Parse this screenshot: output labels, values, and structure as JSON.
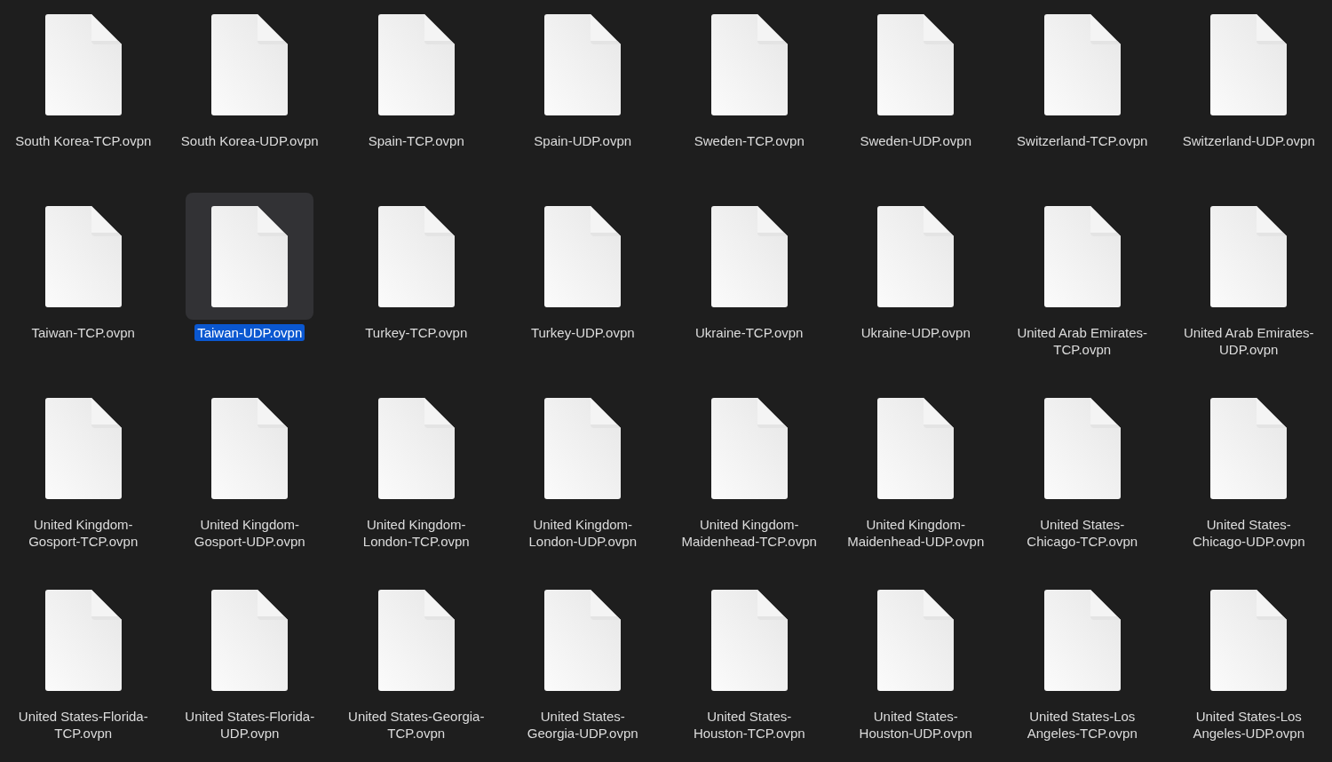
{
  "files": [
    {
      "name_lines": [
        "South Korea-TCP.ovpn"
      ],
      "selected": false
    },
    {
      "name_lines": [
        "South Korea-UDP.ovpn"
      ],
      "selected": false
    },
    {
      "name_lines": [
        "Spain-TCP.ovpn"
      ],
      "selected": false
    },
    {
      "name_lines": [
        "Spain-UDP.ovpn"
      ],
      "selected": false
    },
    {
      "name_lines": [
        "Sweden-TCP.ovpn"
      ],
      "selected": false
    },
    {
      "name_lines": [
        "Sweden-UDP.ovpn"
      ],
      "selected": false
    },
    {
      "name_lines": [
        "Switzerland-TCP.ovpn"
      ],
      "selected": false
    },
    {
      "name_lines": [
        "Switzerland-UDP.ovpn"
      ],
      "selected": false
    },
    {
      "name_lines": [
        "Taiwan-TCP.ovpn"
      ],
      "selected": false
    },
    {
      "name_lines": [
        "Taiwan-UDP.ovpn"
      ],
      "selected": true
    },
    {
      "name_lines": [
        "Turkey-TCP.ovpn"
      ],
      "selected": false
    },
    {
      "name_lines": [
        "Turkey-UDP.ovpn"
      ],
      "selected": false
    },
    {
      "name_lines": [
        "Ukraine-TCP.ovpn"
      ],
      "selected": false
    },
    {
      "name_lines": [
        "Ukraine-UDP.ovpn"
      ],
      "selected": false
    },
    {
      "name_lines": [
        "United Arab Emirates-",
        "TCP.ovpn"
      ],
      "selected": false
    },
    {
      "name_lines": [
        "United Arab Emirates-",
        "UDP.ovpn"
      ],
      "selected": false
    },
    {
      "name_lines": [
        "United Kingdom-",
        "Gosport-TCP.ovpn"
      ],
      "selected": false
    },
    {
      "name_lines": [
        "United Kingdom-",
        "Gosport-UDP.ovpn"
      ],
      "selected": false
    },
    {
      "name_lines": [
        "United Kingdom-",
        "London-TCP.ovpn"
      ],
      "selected": false
    },
    {
      "name_lines": [
        "United Kingdom-",
        "London-UDP.ovpn"
      ],
      "selected": false
    },
    {
      "name_lines": [
        "United Kingdom-",
        "Maidenhead-TCP.ovpn"
      ],
      "selected": false
    },
    {
      "name_lines": [
        "United Kingdom-",
        "Maidenhead-UDP.ovpn"
      ],
      "selected": false
    },
    {
      "name_lines": [
        "United States-",
        "Chicago-TCP.ovpn"
      ],
      "selected": false
    },
    {
      "name_lines": [
        "United States-",
        "Chicago-UDP.ovpn"
      ],
      "selected": false
    },
    {
      "name_lines": [
        "United States-Florida-",
        "TCP.ovpn"
      ],
      "selected": false
    },
    {
      "name_lines": [
        "United States-Florida-",
        "UDP.ovpn"
      ],
      "selected": false
    },
    {
      "name_lines": [
        "United States-Georgia-",
        "TCP.ovpn"
      ],
      "selected": false
    },
    {
      "name_lines": [
        "United States-",
        "Georgia-UDP.ovpn"
      ],
      "selected": false
    },
    {
      "name_lines": [
        "United States-",
        "Houston-TCP.ovpn"
      ],
      "selected": false
    },
    {
      "name_lines": [
        "United States-",
        "Houston-UDP.ovpn"
      ],
      "selected": false
    },
    {
      "name_lines": [
        "United States-Los",
        "Angeles-TCP.ovpn"
      ],
      "selected": false
    },
    {
      "name_lines": [
        "United States-Los",
        "Angeles-UDP.ovpn"
      ],
      "selected": false
    }
  ]
}
